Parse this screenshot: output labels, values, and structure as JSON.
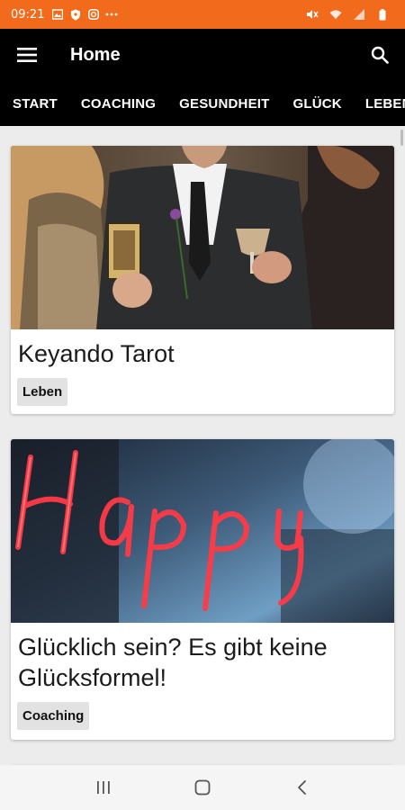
{
  "status_bar": {
    "time": "09:21",
    "left_icons": [
      "image-icon",
      "shield-icon",
      "instagram-icon",
      "more-dots-icon"
    ],
    "right_icons": [
      "mute-icon",
      "wifi-icon",
      "signal-icon",
      "battery-icon"
    ],
    "color": "#f26a1b"
  },
  "app_bar": {
    "title": "Home"
  },
  "tabs": [
    "START",
    "COACHING",
    "GESUNDHEIT",
    "GLÜCK",
    "LEBEN"
  ],
  "cards": [
    {
      "title": "Keyando Tarot",
      "tag": "Leben",
      "image": "tarot-photo"
    },
    {
      "title": "Glücklich sein? Es gibt keine Glücksformel!",
      "tag": "Coaching",
      "image": "happy-neon-photo"
    }
  ]
}
